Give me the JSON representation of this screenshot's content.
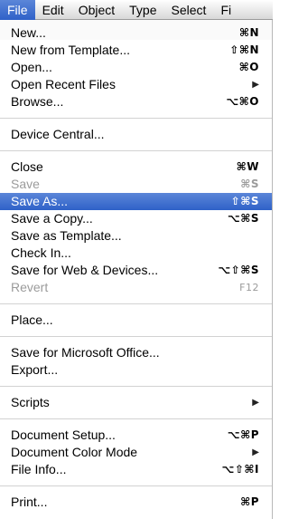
{
  "menubar": {
    "items": [
      "File",
      "Edit",
      "Object",
      "Type",
      "Select",
      "Fi"
    ]
  },
  "file_menu": {
    "groups": [
      [
        {
          "label": "New...",
          "shortcut": "⌘N"
        },
        {
          "label": "New from Template...",
          "shortcut": "⇧⌘N"
        },
        {
          "label": "Open...",
          "shortcut": "⌘O"
        },
        {
          "label": "Open Recent Files",
          "submenu": "▶"
        },
        {
          "label": "Browse...",
          "shortcut": "⌥⌘O"
        }
      ],
      [
        {
          "label": "Device Central..."
        }
      ],
      [
        {
          "label": "Close",
          "shortcut": "⌘W"
        },
        {
          "label": "Save",
          "shortcut": "⌘S",
          "disabled": true
        },
        {
          "label": "Save As...",
          "shortcut": "⇧⌘S",
          "selected": true
        },
        {
          "label": "Save a Copy...",
          "shortcut": "⌥⌘S"
        },
        {
          "label": "Save as Template..."
        },
        {
          "label": "Check In..."
        },
        {
          "label": "Save for Web & Devices...",
          "shortcut": "⌥⇧⌘S"
        },
        {
          "label": "Revert",
          "shortcut": "F12",
          "disabled": true
        }
      ],
      [
        {
          "label": "Place..."
        }
      ],
      [
        {
          "label": "Save for Microsoft Office..."
        },
        {
          "label": "Export..."
        }
      ],
      [
        {
          "label": "Scripts",
          "submenu": "▶"
        }
      ],
      [
        {
          "label": "Document Setup...",
          "shortcut": "⌥⌘P"
        },
        {
          "label": "Document Color Mode",
          "submenu": "▶"
        },
        {
          "label": "File Info...",
          "shortcut": "⌥⇧⌘I"
        }
      ],
      [
        {
          "label": "Print...",
          "shortcut": "⌘P"
        }
      ]
    ]
  }
}
